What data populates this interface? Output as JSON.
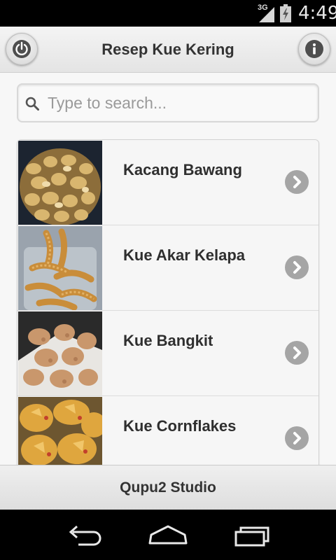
{
  "status_bar": {
    "network": "3G",
    "time": "4:49",
    "icons": [
      "signal-icon",
      "battery-icon"
    ]
  },
  "header": {
    "title": "Resep Kue Kering",
    "left_icon": "power-icon",
    "right_icon": "info-icon"
  },
  "search": {
    "placeholder": "Type to search...",
    "value": "",
    "icon": "search-icon"
  },
  "list": {
    "items": [
      {
        "title": "Kacang Bawang",
        "image": "kacang-bawang-photo"
      },
      {
        "title": "Kue Akar Kelapa",
        "image": "kue-akar-kelapa-photo"
      },
      {
        "title": "Kue Bangkit",
        "image": "kue-bangkit-photo"
      },
      {
        "title": "Kue Cornflakes",
        "image": "kue-cornflakes-photo"
      }
    ],
    "item_icon": "chevron-right-icon"
  },
  "footer": {
    "text": "Qupu2 Studio"
  },
  "nav_bar": {
    "icons": [
      "back-icon",
      "home-icon",
      "recent-apps-icon"
    ]
  },
  "colors": {
    "header_bg": "#e9e9e9",
    "title_text": "#333333",
    "chevron_bg": "#a5a5a5",
    "placeholder_text": "#9a9a9a"
  }
}
